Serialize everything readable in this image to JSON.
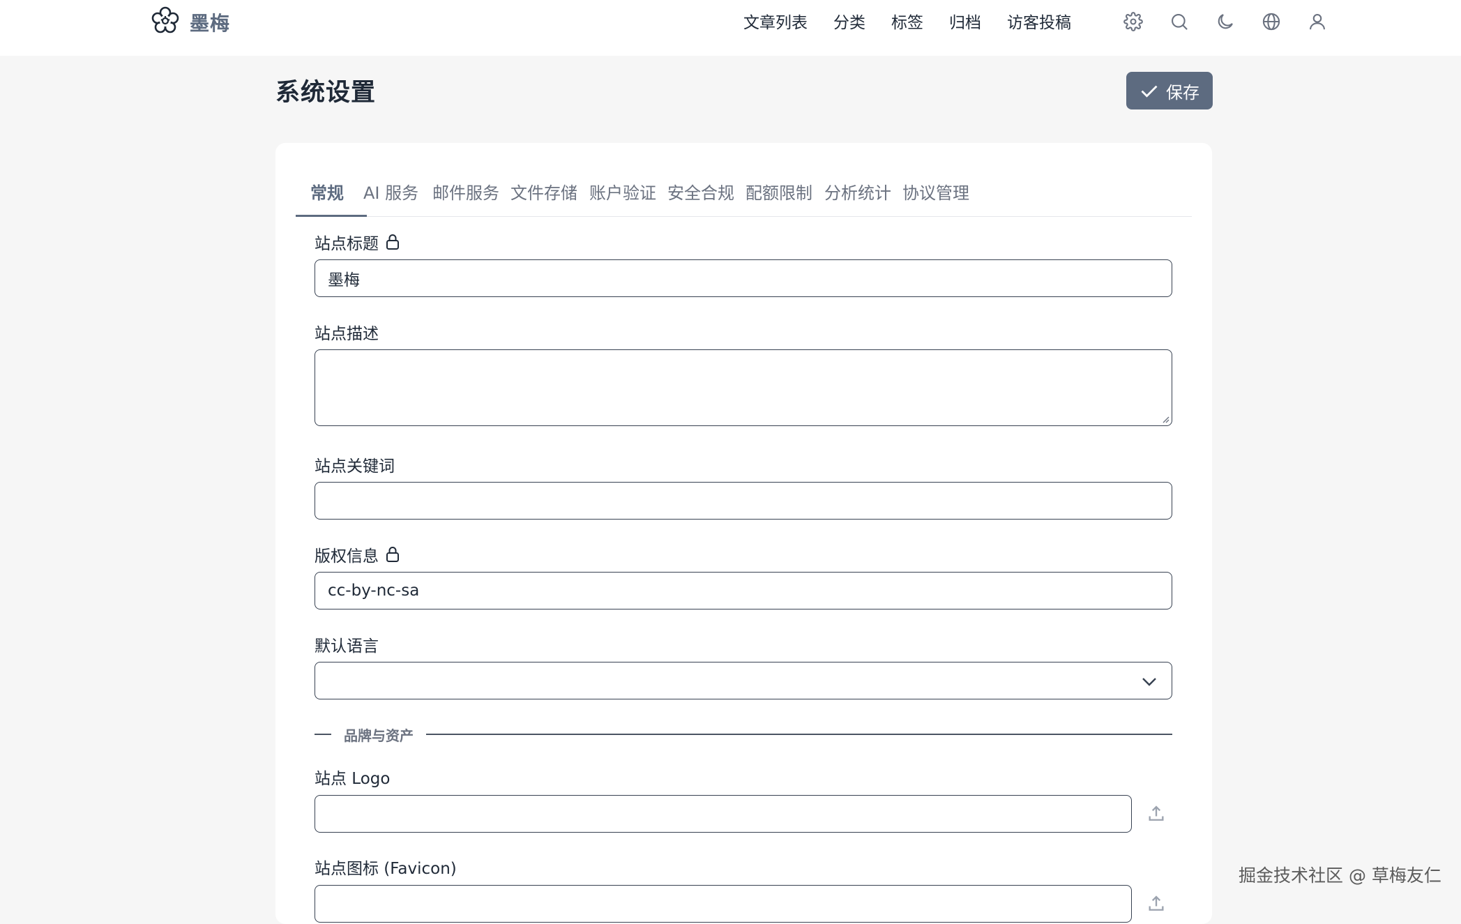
{
  "brand": {
    "name": "墨梅",
    "logo_icon": "plum-blossom-icon"
  },
  "nav": {
    "items": [
      "文章列表",
      "分类",
      "标签",
      "归档",
      "访客投稿"
    ],
    "icons": [
      "gear-icon",
      "search-icon",
      "moon-icon",
      "globe-icon",
      "user-icon"
    ]
  },
  "page": {
    "title": "系统设置",
    "save_label": "保存"
  },
  "tabs": [
    "常规",
    "AI 服务",
    "邮件服务",
    "文件存储",
    "账户验证",
    "安全合规",
    "配额限制",
    "分析统计",
    "协议管理"
  ],
  "active_tab": "常规",
  "fields": {
    "site_title": {
      "label": "站点标题",
      "value": "墨梅",
      "locked": true
    },
    "site_description": {
      "label": "站点描述",
      "value": ""
    },
    "site_keywords": {
      "label": "站点关键词",
      "value": ""
    },
    "copyright": {
      "label": "版权信息",
      "value": "cc-by-nc-sa",
      "locked": true
    },
    "default_language": {
      "label": "默认语言",
      "value": ""
    },
    "section_brand": "品牌与资产",
    "site_logo": {
      "label": "站点 Logo",
      "value": ""
    },
    "site_favicon": {
      "label": "站点图标 (Favicon)",
      "value": ""
    }
  },
  "watermark": "掘金技术社区 @ 草梅友仁",
  "colors": {
    "accent": "#5d6b80",
    "background": "#f6f6f6",
    "card": "#ffffff"
  }
}
